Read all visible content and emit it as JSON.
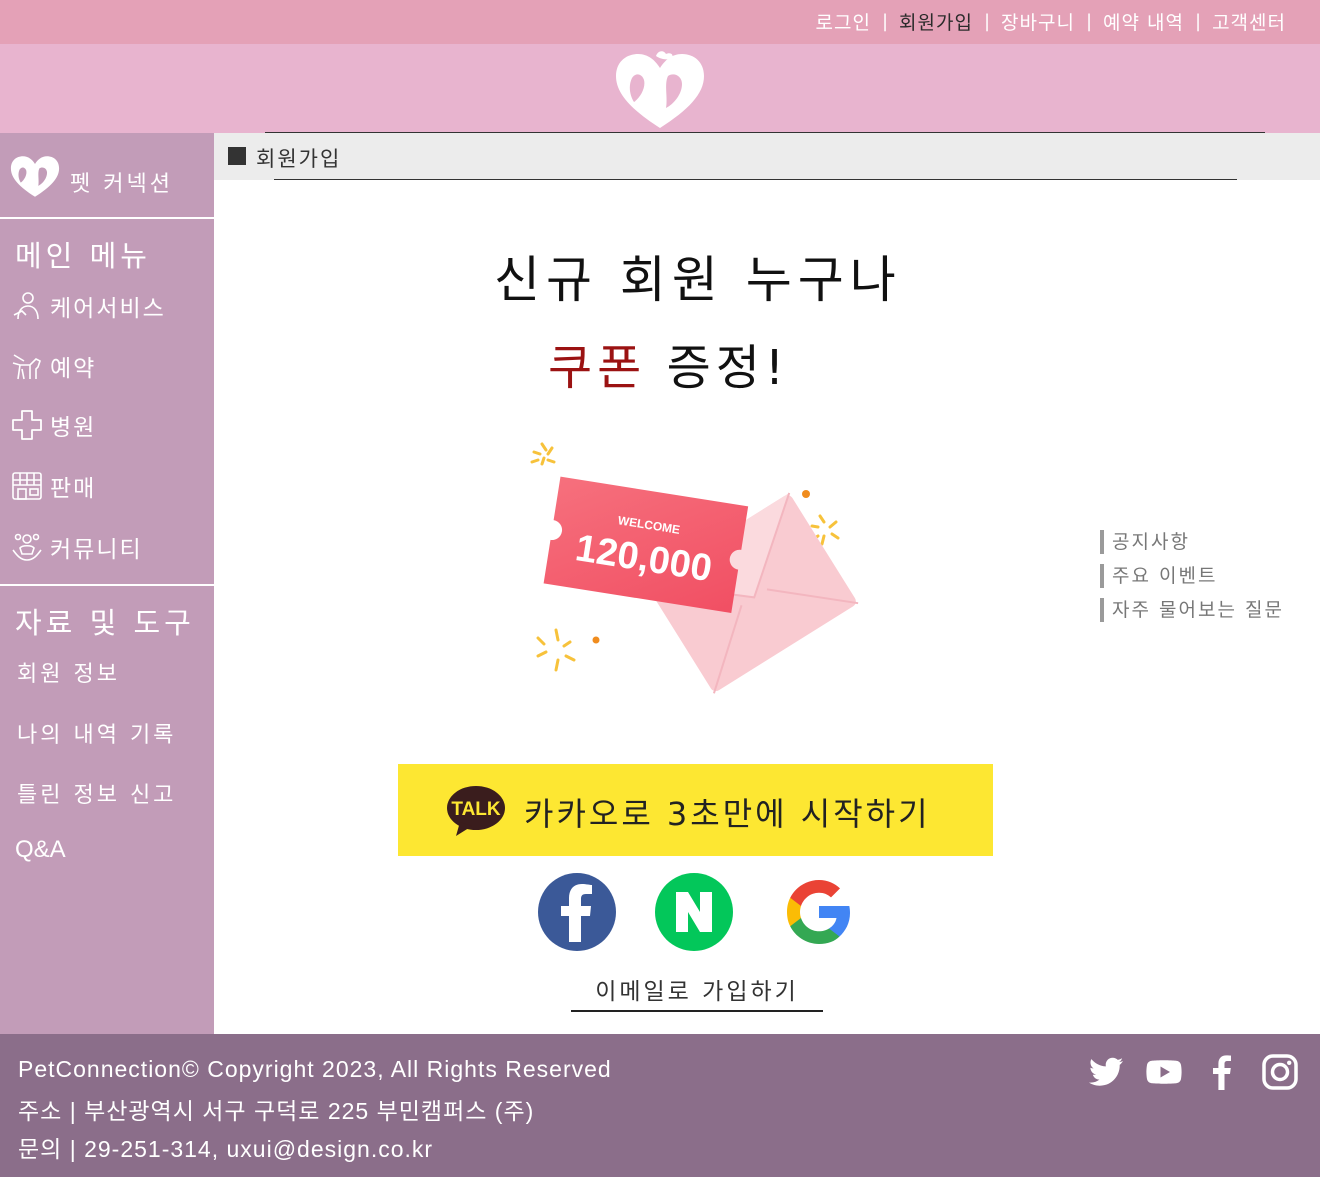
{
  "topnav": {
    "items": [
      {
        "label": "로그인"
      },
      {
        "label": "회원가입"
      },
      {
        "label": "장바구니"
      },
      {
        "label": "예약 내역"
      },
      {
        "label": "고객센터"
      }
    ],
    "separator": "|"
  },
  "sidebar": {
    "brand": "펫 커넥션",
    "main_title": "메인 메뉴",
    "main_items": [
      {
        "label": "케어서비스",
        "icon": "care-icon"
      },
      {
        "label": "예약",
        "icon": "dog-icon"
      },
      {
        "label": "병원",
        "icon": "cross-icon"
      },
      {
        "label": "판매",
        "icon": "store-icon"
      },
      {
        "label": "커뮤니티",
        "icon": "community-icon"
      }
    ],
    "tools_title": "자료 및 도구",
    "tools_items": [
      {
        "label": "회원 정보"
      },
      {
        "label": "나의 내역 기록"
      },
      {
        "label": "틀린 정보 신고"
      },
      {
        "label": "Q&A"
      }
    ]
  },
  "breadcrumb": {
    "label": "회원가입"
  },
  "promo": {
    "line1": "신규 회원 누구나",
    "line2_highlight": "쿠폰",
    "line2_rest": "증정!",
    "coupon_label": "WELCOME",
    "coupon_amount": "120,000",
    "highlight_color": "#9b1212"
  },
  "signup": {
    "kakao_badge": "TALK",
    "kakao_label": "카카오로 3초만에 시작하기",
    "email_label": "이메일로 가입하기",
    "kakao_color": "#fde732"
  },
  "side_links": [
    {
      "label": "공지사항"
    },
    {
      "label": "주요 이벤트"
    },
    {
      "label": "자주 물어보는 질문"
    }
  ],
  "footer": {
    "copyright": "PetConnection© Copyright 2023, All Rights Reserved",
    "address": "주소 | 부산광역시 서구 구덕로 225 부민캠퍼스 (주)",
    "contact": "문의 | 29-251-314, uxui@design.co.kr"
  },
  "colors": {
    "topnav": "#e4a1b7",
    "header": "#e8b4cf",
    "sidebar": "#c29cb8",
    "footer": "#8b6e8a"
  }
}
